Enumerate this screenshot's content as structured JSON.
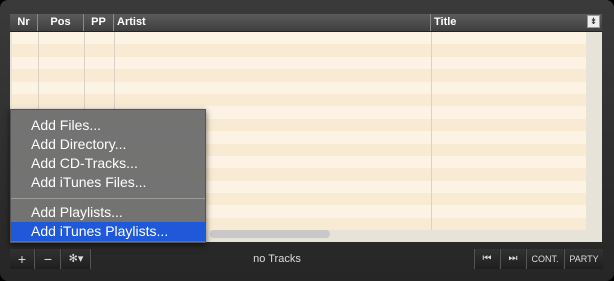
{
  "columns": [
    "Nr",
    "Pos",
    "PP",
    "Artist",
    "Title"
  ],
  "menu": {
    "items": [
      "Add Files...",
      "Add Directory...",
      "Add CD-Tracks...",
      "Add iTunes Files..."
    ],
    "items2": [
      "Add Playlists...",
      "Add iTunes Playlists..."
    ],
    "highlighted_color": "#1f58d8"
  },
  "toolbar": {
    "add_icon": "plus-icon",
    "remove_icon": "minus-icon",
    "gear_icon": "gear-icon",
    "status": "no Tracks",
    "prev_icon": "previous-icon",
    "next_icon": "next-icon",
    "cont_label": "CONT.",
    "party_label": "PARTY"
  },
  "symbols": {
    "plus": "+",
    "minus": "−",
    "gear": "✻▾",
    "prev": "⏮",
    "next": "⏭",
    "sort": "⇟"
  }
}
